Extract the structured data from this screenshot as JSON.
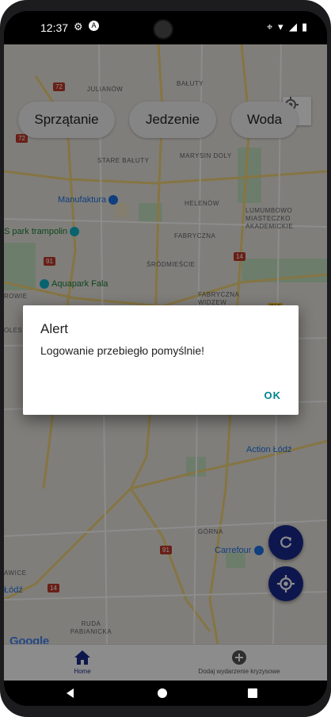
{
  "status_bar": {
    "time": "12:37"
  },
  "map": {
    "district_labels": [
      "JULIANÓW",
      "BAŁUTY",
      "STARE BAŁUTY",
      "MARYSIN DOLY",
      "HELENÓW",
      "FABRYCZNA",
      "ŚRÓDMIEŚCIE",
      "FABRYCZNA WIDZEW",
      "LUMUMBOWO MIASTECZKO AKADEMICKIE",
      "GÓRNA",
      "RUDA PABIANICKA",
      "ROWIE",
      "OLES",
      "AWICE"
    ],
    "places": [
      "Manufaktura",
      "S park trampolin",
      "Aquapark Fala",
      "Action Łódź",
      "Carrefour",
      "Łódź"
    ],
    "road_numbers": [
      "72",
      "72",
      "91",
      "14",
      "713",
      "91",
      "14"
    ],
    "attribution": "Google"
  },
  "categories": [
    "Sprzątanie",
    "Jedzenie",
    "Woda"
  ],
  "tabs": [
    {
      "label": "Home",
      "icon": "home-icon",
      "active": true
    },
    {
      "label": "Dodaj wydarzenie kryzysowe",
      "icon": "add-circle-icon",
      "active": false
    }
  ],
  "dialog": {
    "title": "Alert",
    "message": "Logowanie przebiegło pomyślnie!",
    "ok_label": "OK"
  },
  "colors": {
    "accent_dialog": "#00838f",
    "fab": "#1a2a8c",
    "tab_active": "#1a2a8c"
  }
}
